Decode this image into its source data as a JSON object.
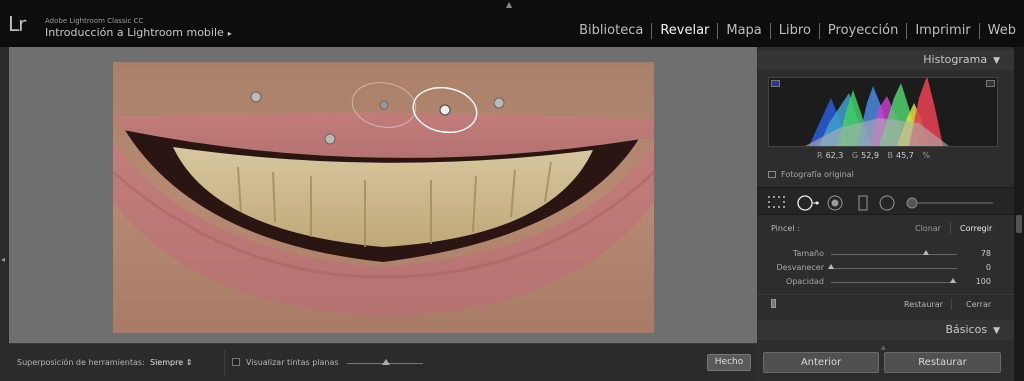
{
  "header": {
    "logo": "Lr",
    "app_name": "Adobe Lightroom Classic CC",
    "catalog_name": "Introducción a Lightroom mobile",
    "catalog_arrow": "▸",
    "modules": [
      "Biblioteca",
      "Revelar",
      "Mapa",
      "Libro",
      "Proyección",
      "Imprimir",
      "Web"
    ],
    "active_module": "Revelar"
  },
  "toolbar": {
    "overlay_label": "Superposición de herramientas:",
    "overlay_value": "Siempre",
    "visualize_label": "Visualizar tintas planas",
    "done_label": "Hecho"
  },
  "right_panel": {
    "histogram_title": "Histograma",
    "rgb": {
      "r_label": "R",
      "r_value": "62,3",
      "g_label": "G",
      "g_value": "52,9",
      "b_label": "B",
      "b_value": "45,7",
      "unit": "%"
    },
    "original_photo_label": "Fotografía original",
    "brush_label": "Pincel :",
    "clone_label": "Clonar",
    "heal_label": "Corregir",
    "sliders": [
      {
        "label": "Tamaño",
        "value": "78",
        "fraction": 0.78
      },
      {
        "label": "Desvanecer",
        "value": "0",
        "fraction": 0.0
      },
      {
        "label": "Opacidad",
        "value": "100",
        "fraction": 1.0
      }
    ],
    "reset_label": "Restaurar",
    "close_label": "Cerrar",
    "basics_title": "Básicos",
    "prev_button": "Anterior",
    "reset_button": "Restaurar"
  },
  "colors": {
    "topbar": "#0d0d0d",
    "canvas": "#6f6f6f",
    "panel": "#2d2d2d",
    "spot_outline": "#ffffff"
  }
}
